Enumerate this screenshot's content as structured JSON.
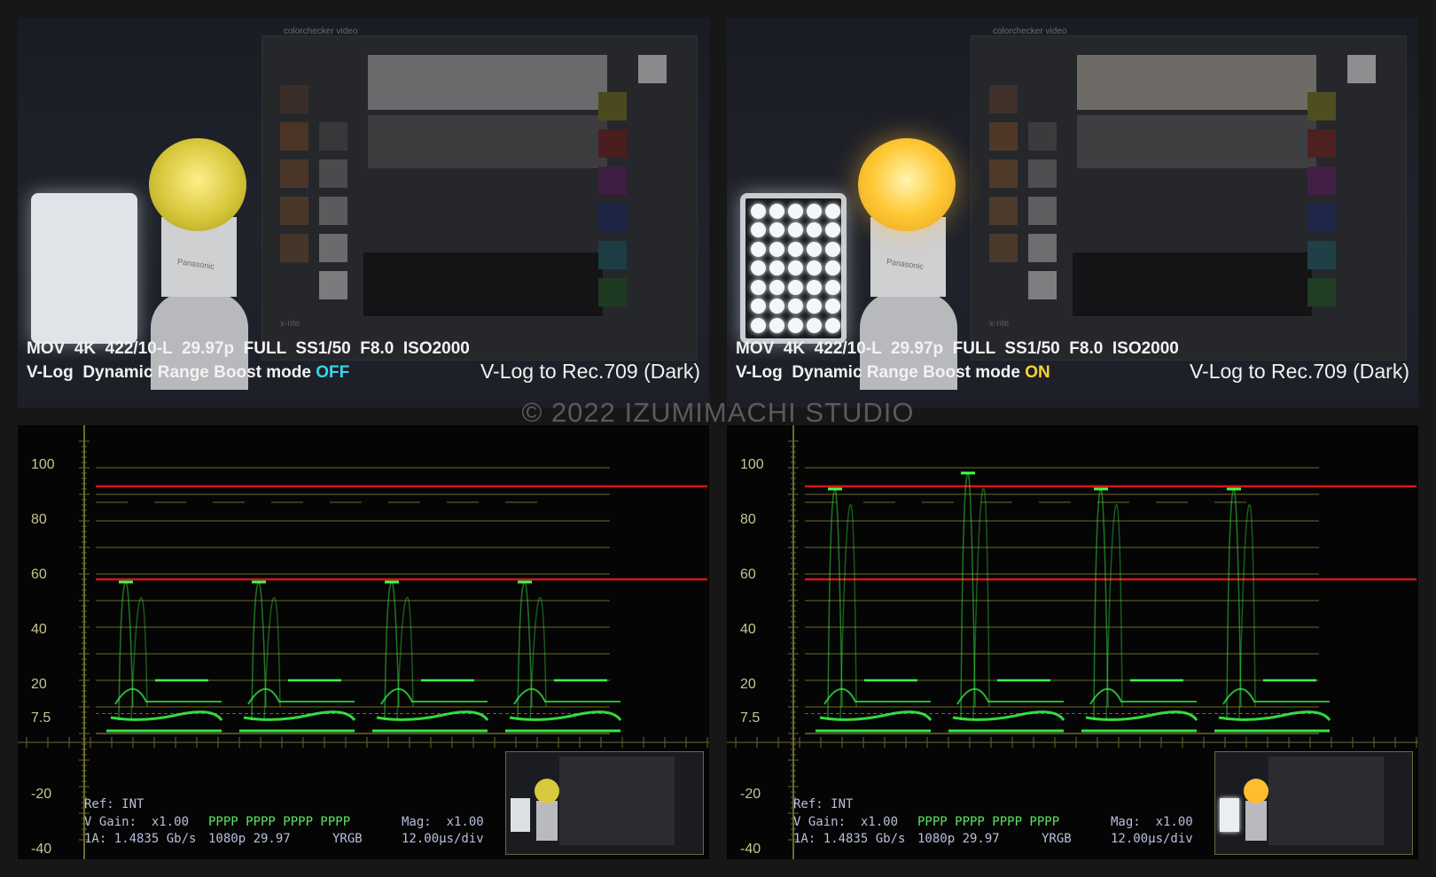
{
  "panels": [
    {
      "id": "left",
      "settings_line": "MOV  4K  422/10-L  29.97p  FULL  SS1/50  F8.0  ISO2000",
      "mode_prefix": "V-Log  Dynamic Range Boost mode ",
      "mode_value": "OFF",
      "caption": "V-Log to Rec.709 (Dark)",
      "card_brand": "colorchecker video",
      "card_logo": "x-rite",
      "bulb_brand": "Panasonic"
    },
    {
      "id": "right",
      "settings_line": "MOV  4K  422/10-L  29.97p  FULL  SS1/50  F8.0  ISO2000",
      "mode_prefix": "V-Log  Dynamic Range Boost mode ",
      "mode_value": "ON",
      "caption": "V-Log to Rec.709 (Dark)",
      "card_brand": "colorchecker video",
      "card_logo": "x-rite",
      "bulb_brand": "Panasonic"
    }
  ],
  "copyright": "© 2022 IZUMIMACHI STUDIO",
  "scope_axis": [
    "100",
    "80",
    "60",
    "40",
    "20",
    "7.5",
    "-20",
    "-40"
  ],
  "scopes": [
    {
      "ref": "Ref: INT",
      "vgain": "V Gain:  x1.00",
      "pattern": "PPPP PPPP PPPP PPPP",
      "mag": "Mag:  x1.00",
      "link": "1A: 1.4835 Gb/s",
      "format": "1080p 29.97",
      "mode": "YRGB",
      "timebase": "12.00µs/div"
    },
    {
      "ref": "Ref: INT",
      "vgain": "V Gain:  x1.00",
      "pattern": "PPPP PPPP PPPP PPPP",
      "mag": "Mag:  x1.00",
      "link": "1A: 1.4835 Gb/s",
      "format": "1080p 29.97",
      "mode": "YRGB",
      "timebase": "12.00µs/div"
    }
  ],
  "chart_data": [
    {
      "type": "line",
      "ylim": [
        -40,
        110
      ],
      "yticks": [
        100,
        80,
        60,
        40,
        20,
        7.5,
        -20,
        -40
      ],
      "reference_lines": [
        93,
        58
      ],
      "peaks": [
        57,
        57,
        57,
        57
      ],
      "colors": {
        "trace": "#3cff4a",
        "reference": "#d81515",
        "grid": "#6b6a2a"
      }
    },
    {
      "type": "line",
      "ylim": [
        -40,
        110
      ],
      "yticks": [
        100,
        80,
        60,
        40,
        20,
        7.5,
        -20,
        -40
      ],
      "reference_lines": [
        93,
        58
      ],
      "peaks": [
        92,
        98,
        92,
        92
      ],
      "colors": {
        "trace": "#3cff4a",
        "reference": "#d81515",
        "grid": "#6b6a2a"
      }
    }
  ]
}
